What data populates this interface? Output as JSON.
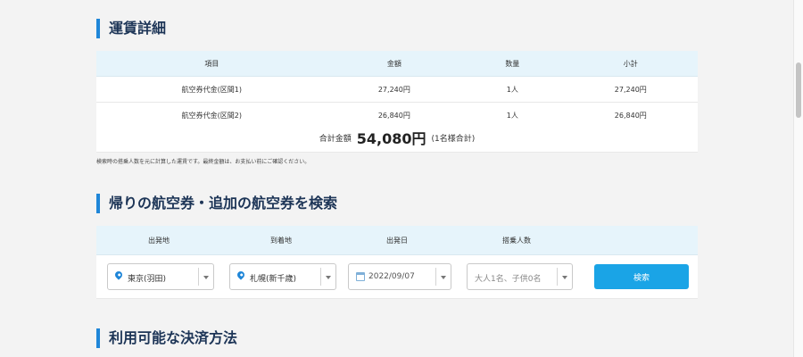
{
  "fare_details": {
    "heading": "運賃詳細",
    "columns": [
      "項目",
      "金額",
      "数量",
      "小計"
    ],
    "rows": [
      {
        "item": "航空券代金(区間1)",
        "amount": "27,240円",
        "qty": "1人",
        "subtotal": "27,240円"
      },
      {
        "item": "航空券代金(区間2)",
        "amount": "26,840円",
        "qty": "1人",
        "subtotal": "26,840円"
      }
    ],
    "total_label": "合計金額",
    "total_amount": "54,080円",
    "total_note": "(1名様合計)",
    "note": "検索時の搭乗人数を元に計算した運賃です。最終金額は、お支払い前にご確認ください。"
  },
  "search": {
    "heading": "帰りの航空券・追加の航空券を検索",
    "labels": {
      "origin": "出発地",
      "destination": "到着地",
      "date": "出発日",
      "passengers": "搭乗人数"
    },
    "origin_value": "東京(羽田)",
    "destination_value": "札幌(新千歳)",
    "date_value": "2022/09/07",
    "passengers_placeholder": "大人1名、子供0名",
    "button_label": "検索"
  },
  "payment": {
    "heading": "利用可能な決済方法"
  },
  "colors": {
    "accent": "#1f86d8",
    "header_bg": "#e6f4fb",
    "button": "#1aa4e6",
    "background": "#f3f3f3"
  },
  "icons": {
    "origin": "map-pin-icon",
    "destination": "map-pin-icon",
    "date": "calendar-icon",
    "dropdown": "chevron-down-icon"
  }
}
